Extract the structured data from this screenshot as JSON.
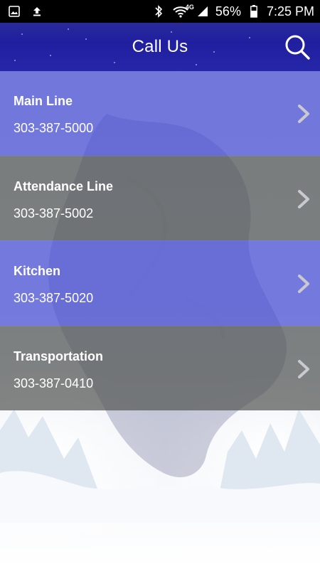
{
  "status_bar": {
    "battery": "56%",
    "time": "7:25 PM",
    "network": "4G",
    "icons": [
      "image-icon",
      "upload-icon",
      "bluetooth-icon",
      "wifi-icon",
      "signal-icon",
      "battery-icon"
    ]
  },
  "header": {
    "title": "Call Us",
    "search_icon": "search-icon"
  },
  "contacts": [
    {
      "name": "Main Line",
      "phone": "303-387-5000",
      "style": "blue"
    },
    {
      "name": "Attendance Line",
      "phone": "303-387-5002",
      "style": "gray"
    },
    {
      "name": "Kitchen",
      "phone": "303-387-5020",
      "style": "blue"
    },
    {
      "name": "Transportation",
      "phone": "303-387-0410",
      "style": "gray"
    }
  ],
  "colors": {
    "header": "#2626a8",
    "row_blue": "#4b50d7",
    "row_gray": "#555855",
    "text": "#ffffff"
  }
}
